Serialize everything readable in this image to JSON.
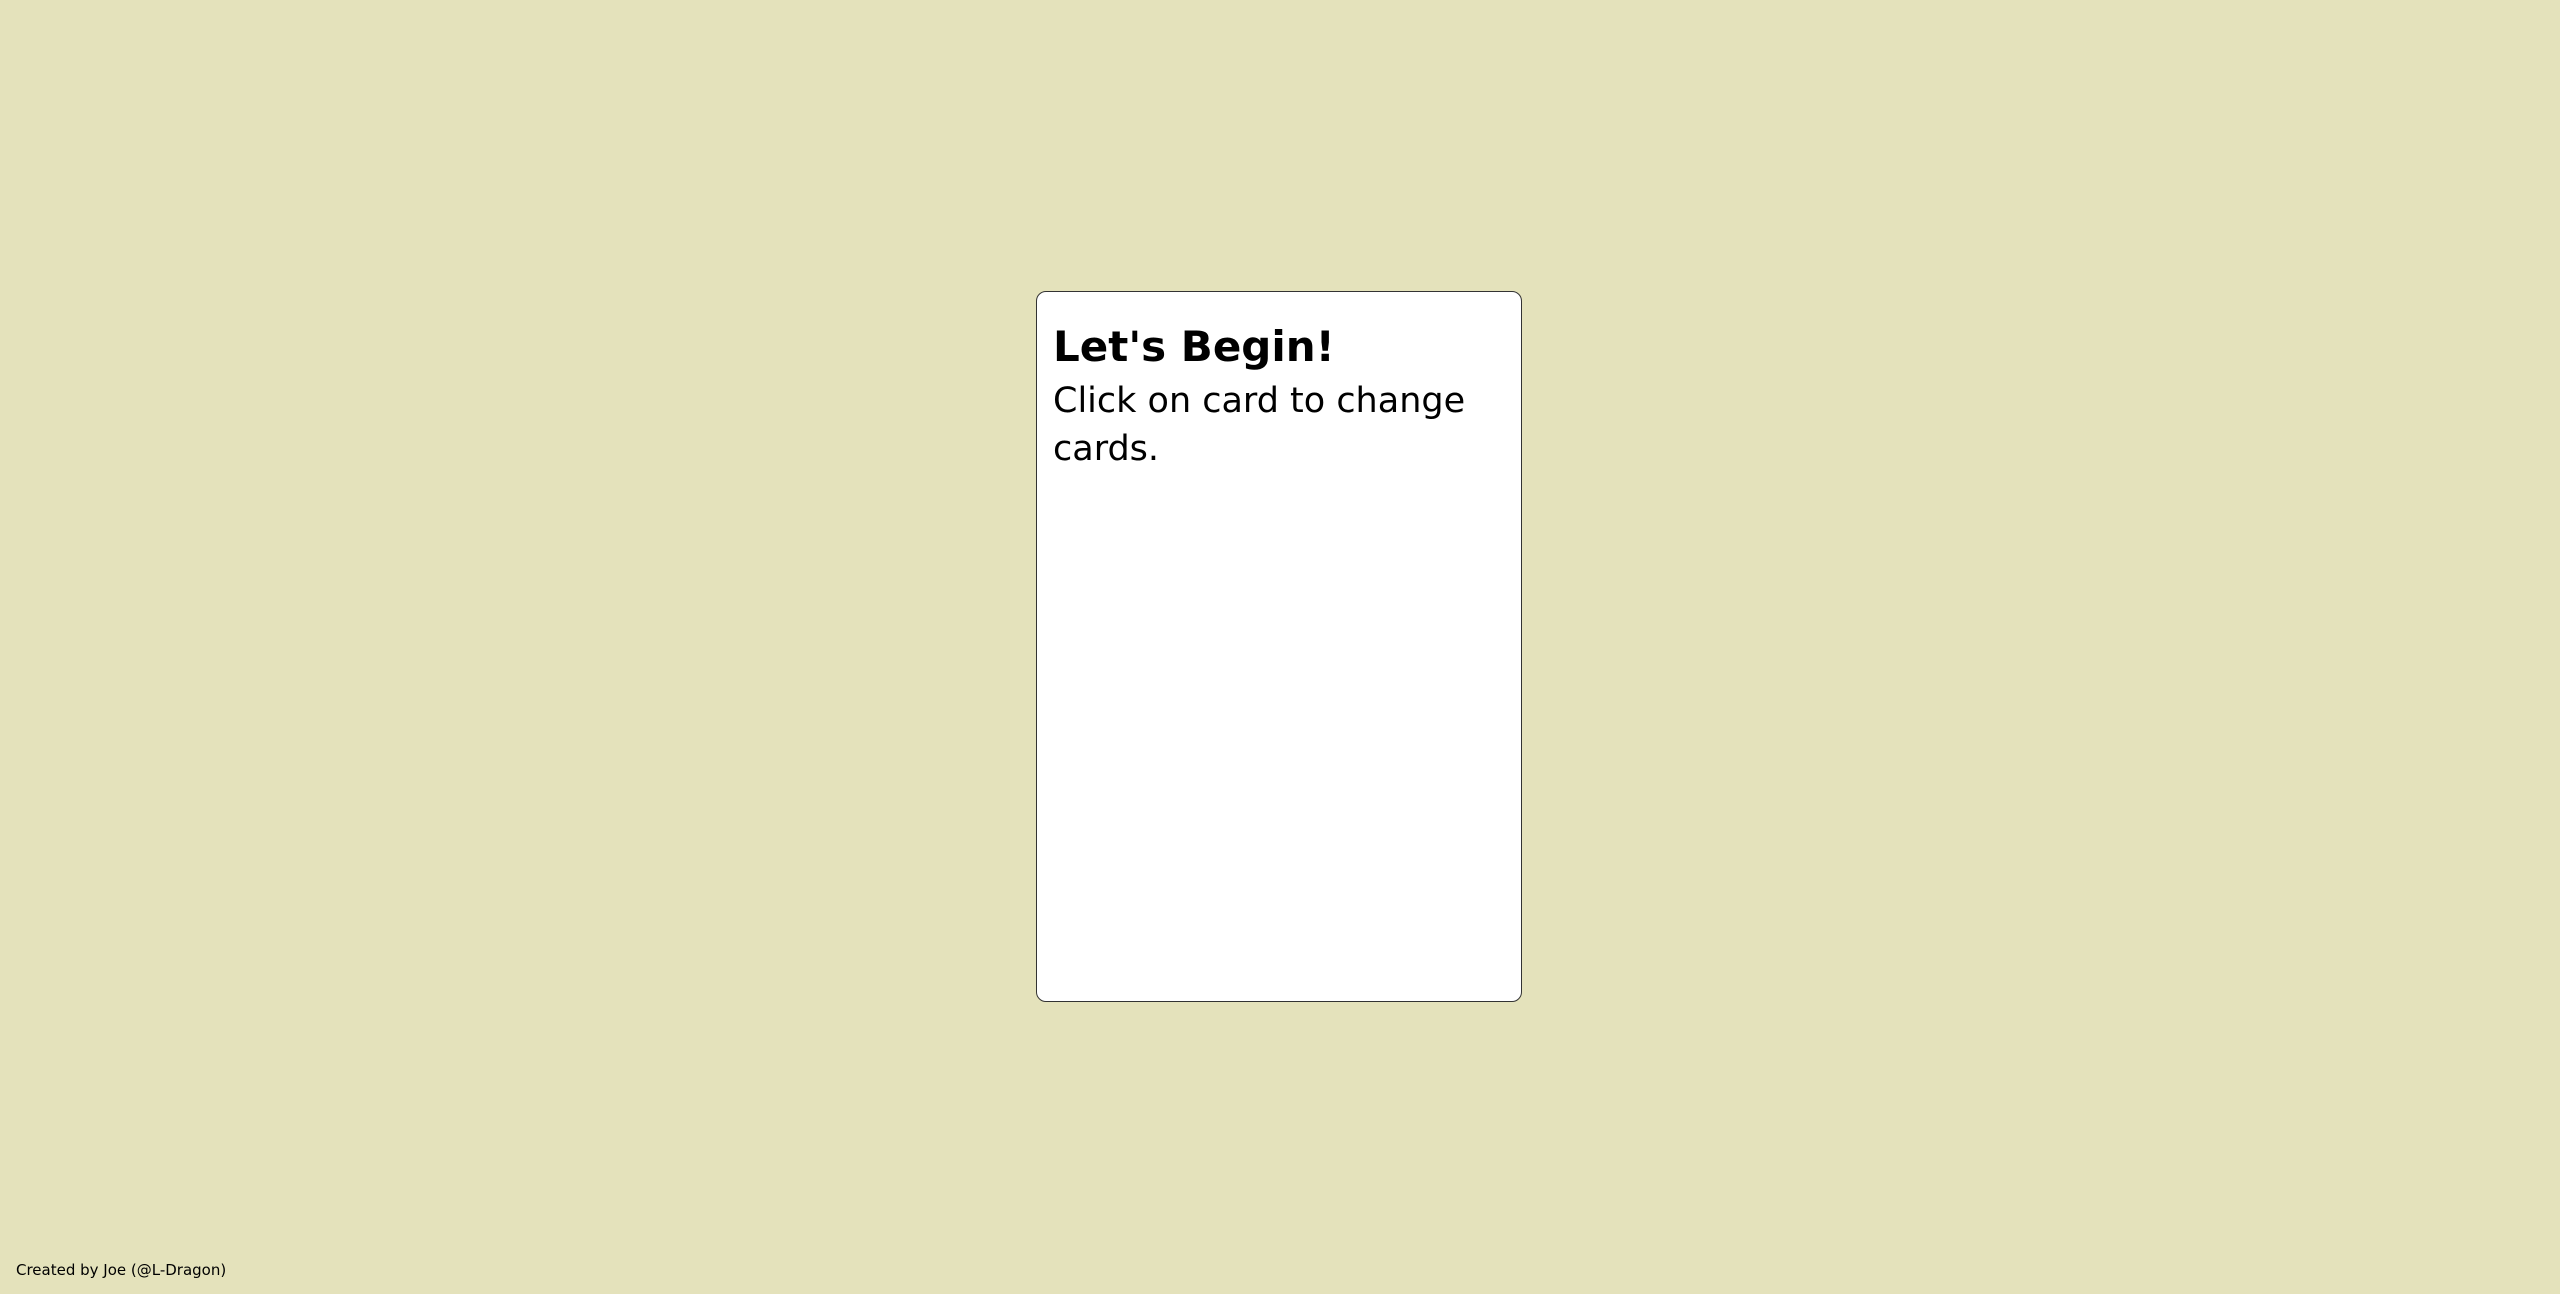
{
  "card": {
    "title": "Let's Begin!",
    "text": "Click on card to change cards."
  },
  "footer": {
    "credit": "Created by Joe (@L-Dragon)"
  },
  "colors": {
    "background": "#e4e2bb",
    "card": "#ffffff",
    "border": "#333333"
  }
}
